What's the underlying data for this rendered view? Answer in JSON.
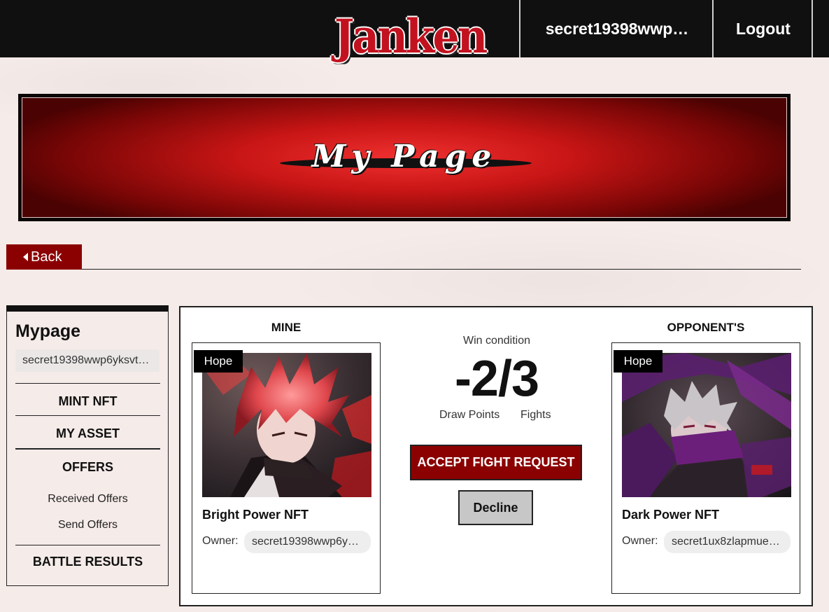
{
  "header": {
    "logo": "Janken",
    "user": "secret19398wwp…",
    "logout": "Logout"
  },
  "banner": {
    "title": "My Page"
  },
  "back": {
    "label": "Back"
  },
  "sidebar": {
    "title": "Mypage",
    "address": "secret19398wwp6yksvt…",
    "items": {
      "mint": "MINT NFT",
      "asset": "MY ASSET",
      "offers": "OFFERS",
      "received": "Received Offers",
      "send": "Send Offers",
      "battle": "BATTLE RESULTS"
    }
  },
  "mine": {
    "heading": "MINE",
    "tag": "Hope",
    "name": "Bright Power NFT",
    "owner_label": "Owner:",
    "owner": "secret19398wwp6y…"
  },
  "opponent": {
    "heading": "OPPONENT'S",
    "tag": "Hope",
    "name": "Dark Power NFT",
    "owner_label": "Owner:",
    "owner": "secret1ux8zlapmue…"
  },
  "battle": {
    "win_condition_label": "Win condition",
    "score": "-2/3",
    "draw_points_label": "Draw Points",
    "fights_label": "Fights",
    "accept_label": "ACCEPT FIGHT REQUEST",
    "decline_label": "Decline"
  },
  "colors": {
    "accent": "#8b0000",
    "header_bg": "#111010",
    "page_bg": "#f5ebe9"
  }
}
